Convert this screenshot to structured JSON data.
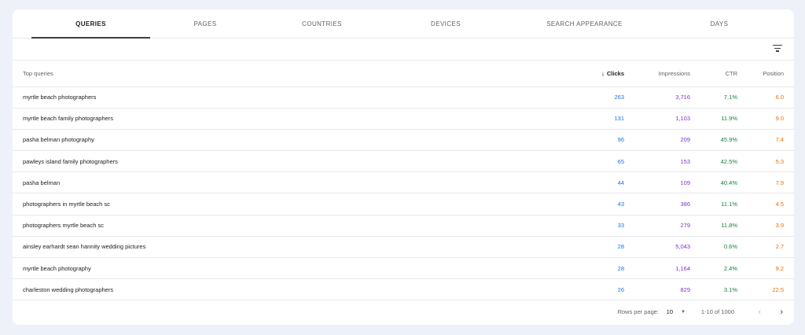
{
  "tabs": [
    {
      "label": "QUERIES",
      "active": true
    },
    {
      "label": "PAGES",
      "active": false
    },
    {
      "label": "COUNTRIES",
      "active": false
    },
    {
      "label": "DEVICES",
      "active": false
    },
    {
      "label": "SEARCH APPEARANCE",
      "active": false
    },
    {
      "label": "DAYS",
      "active": false
    }
  ],
  "icons": {
    "filter": "filter-icon",
    "sort": "arrow-down-icon",
    "prev": "chevron-left-icon",
    "next": "chevron-right-icon",
    "dropdown": "caret-down-icon"
  },
  "colors": {
    "clicks": "#1a73e8",
    "impressions": "#8430ce",
    "ctr": "#188038",
    "position": "#e8710a"
  },
  "table": {
    "headers": {
      "query": "Top queries",
      "clicks": "Clicks",
      "impressions": "Impressions",
      "ctr": "CTR",
      "position": "Position"
    },
    "sort_arrow": "↓",
    "rows": [
      {
        "query": "myrtle beach photographers",
        "clicks": "263",
        "impressions": "3,716",
        "ctr": "7.1%",
        "position": "6.0"
      },
      {
        "query": "myrtle beach family photographers",
        "clicks": "131",
        "impressions": "1,103",
        "ctr": "11.9%",
        "position": "9.0"
      },
      {
        "query": "pasha belman photography",
        "clicks": "96",
        "impressions": "209",
        "ctr": "45.9%",
        "position": "7.4"
      },
      {
        "query": "pawleys island family photographers",
        "clicks": "65",
        "impressions": "153",
        "ctr": "42.5%",
        "position": "5.3"
      },
      {
        "query": "pasha belman",
        "clicks": "44",
        "impressions": "109",
        "ctr": "40.4%",
        "position": "7.9"
      },
      {
        "query": "photographers in myrtle beach sc",
        "clicks": "43",
        "impressions": "386",
        "ctr": "11.1%",
        "position": "4.5"
      },
      {
        "query": "photographers myrtle beach sc",
        "clicks": "33",
        "impressions": "279",
        "ctr": "11.8%",
        "position": "3.9"
      },
      {
        "query": "ainsley earhardt sean hannity wedding pictures",
        "clicks": "28",
        "impressions": "5,043",
        "ctr": "0.6%",
        "position": "2.7"
      },
      {
        "query": "myrtle beach photography",
        "clicks": "28",
        "impressions": "1,164",
        "ctr": "2.4%",
        "position": "9.2"
      },
      {
        "query": "charleston wedding photographers",
        "clicks": "26",
        "impressions": "829",
        "ctr": "3.1%",
        "position": "22.5"
      }
    ]
  },
  "pagination": {
    "rows_per_page_label": "Rows per page:",
    "rows_per_page_value": "10",
    "range": "1-10 of 1000",
    "prev": "‹",
    "next": "›",
    "caret": "▼"
  }
}
